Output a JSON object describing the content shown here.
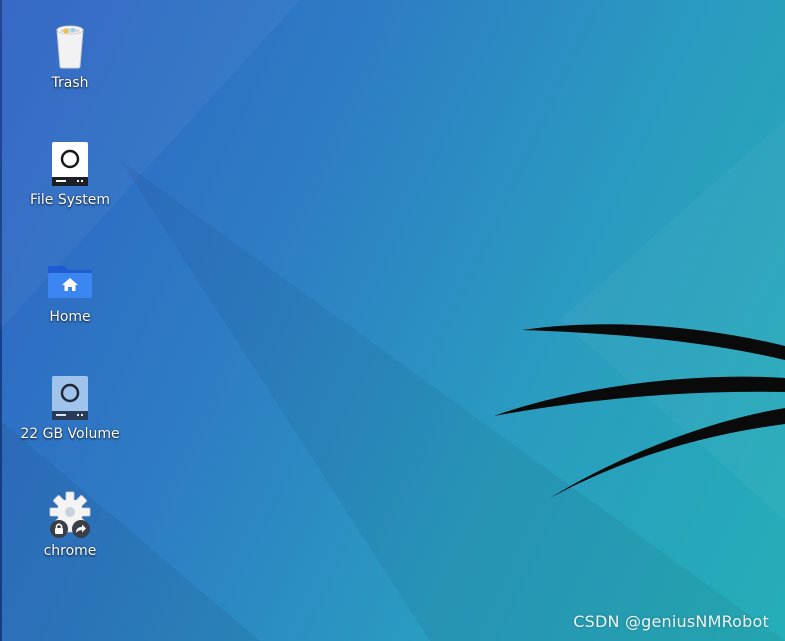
{
  "desktop": {
    "background_colors": [
      "#2f63c4",
      "#2a9bc0",
      "#25aeb7"
    ],
    "icons": [
      {
        "label": "Trash",
        "icon": "trash-icon"
      },
      {
        "label": "File System",
        "icon": "drive-icon"
      },
      {
        "label": "Home",
        "icon": "home-folder-icon"
      },
      {
        "label": "22 GB Volume",
        "icon": "volume-drive-icon"
      },
      {
        "label": "chrome",
        "icon": "gear-icon"
      }
    ]
  },
  "watermark": "CSDN @geniusNMRobot"
}
